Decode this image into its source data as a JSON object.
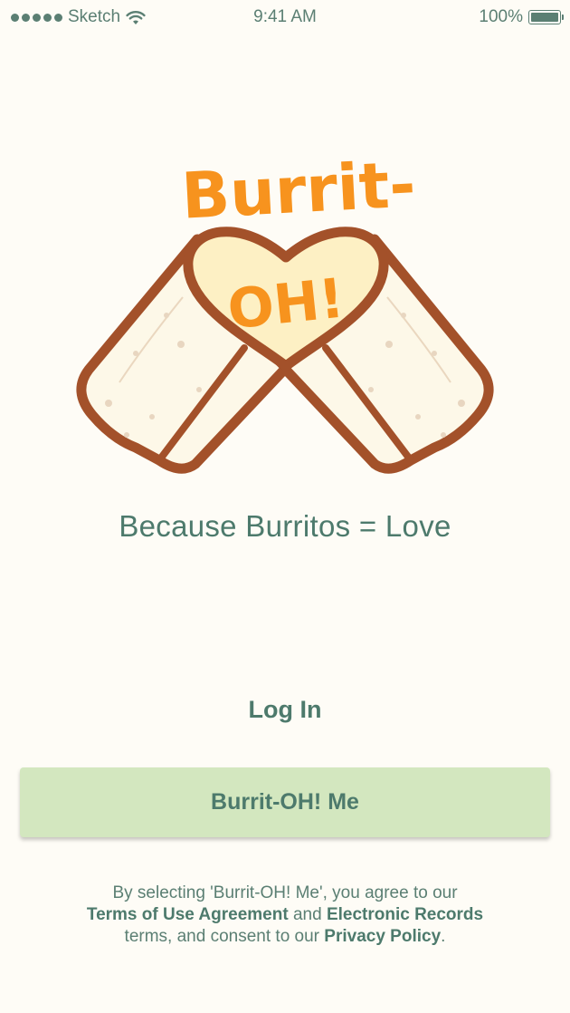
{
  "status_bar": {
    "carrier": "Sketch",
    "time": "9:41 AM",
    "battery": "100%"
  },
  "logo": {
    "top_text": "Burrit-",
    "heart_text": "OH!",
    "colors": {
      "orange": "#f7931e",
      "brown": "#a3512a",
      "tortilla": "#fdf8e8",
      "heart": "#fdf0c4"
    }
  },
  "tagline": "Because Burritos = Love",
  "actions": {
    "login_label": "Log In",
    "primary_label": "Burrit-OH! Me"
  },
  "terms": {
    "line1": "By selecting 'Burrit-OH! Me', you agree to our",
    "terms_link": "Terms of Use Agreement",
    "and": " and ",
    "records_link": "Electronic Records",
    "line3_prefix": "terms, and consent to our ",
    "privacy_link": "Privacy Policy",
    "period": "."
  },
  "colors": {
    "background": "#fefcf6",
    "text": "#4d7a6c",
    "button": "#d3e7bf"
  }
}
